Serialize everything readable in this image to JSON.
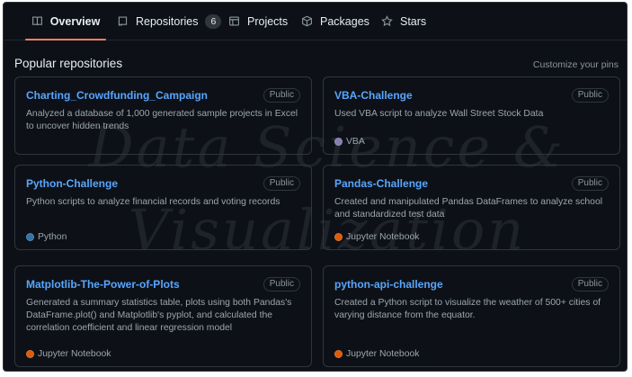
{
  "nav": {
    "tabs": [
      {
        "label": "Overview",
        "icon": "book-icon"
      },
      {
        "label": "Repositories",
        "icon": "repo-icon",
        "count": "6"
      },
      {
        "label": "Projects",
        "icon": "table-icon"
      },
      {
        "label": "Packages",
        "icon": "package-icon"
      },
      {
        "label": "Stars",
        "icon": "star-icon"
      }
    ]
  },
  "section": {
    "title": "Popular repositories",
    "customize": "Customize your pins"
  },
  "watermark": {
    "line1": "Data Science &",
    "line2": "Visualization"
  },
  "repos": [
    {
      "name": "Charting_Crowdfunding_Campaign",
      "visibility": "Public",
      "description": "Analyzed a database of 1,000 generated sample projects in Excel to uncover hidden trends",
      "language": "",
      "language_color": ""
    },
    {
      "name": "VBA-Challenge",
      "visibility": "Public",
      "description": "Used VBA script to analyze Wall Street Stock Data",
      "language": "VBA",
      "language_color": "#867db1"
    },
    {
      "name": "Python-Challenge",
      "visibility": "Public",
      "description": "Python scripts to analyze financial records and voting records",
      "language": "Python",
      "language_color": "#3572A5"
    },
    {
      "name": "Pandas-Challenge",
      "visibility": "Public",
      "description": "Created and manipulated Pandas DataFrames to analyze school and standardized test data",
      "language": "Jupyter Notebook",
      "language_color": "#DA5B0B"
    },
    {
      "name": "Matplotlib-The-Power-of-Plots",
      "visibility": "Public",
      "description": "Generated a summary statistics table, plots using both Pandas's DataFrame.plot() and Matplotlib's pyplot, and calculated the correlation coefficient and linear regression model",
      "language": "Jupyter Notebook",
      "language_color": "#DA5B0B"
    },
    {
      "name": "python-api-challenge",
      "visibility": "Public",
      "description": "Created a Python script to visualize the weather of 500+ cities of varying distance from the equator.",
      "language": "Jupyter Notebook",
      "language_color": "#DA5B0B"
    }
  ],
  "colors": {
    "accent_underline": "#f78166",
    "link": "#58a6ff",
    "background": "#0d1117"
  }
}
